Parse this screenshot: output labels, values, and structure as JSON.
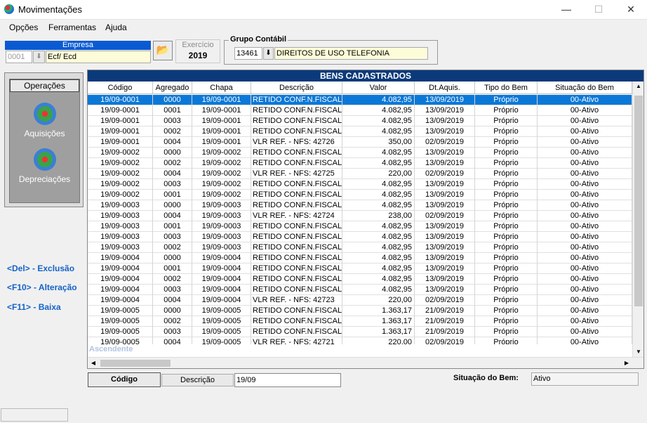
{
  "window": {
    "title": "Movimentações"
  },
  "menu": {
    "items": [
      "Opções",
      "Ferramentas",
      "Ajuda"
    ]
  },
  "empresa": {
    "label": "Empresa",
    "code": "0001",
    "name": "Ecf/ Ecd"
  },
  "exercicio": {
    "label": "Exercício",
    "value": "2019"
  },
  "grupo": {
    "label": "Grupo  Contábil",
    "code": "13461",
    "name": "DIREITOS DE USO TELEFONIA"
  },
  "operacoes": {
    "title": "Operações",
    "items": [
      "Aquisições",
      "Depreciações"
    ]
  },
  "hotkeys": [
    "<Del> - Exclusão",
    "<F10> - Alteração",
    "<F11> - Baixa"
  ],
  "grid": {
    "title": "BENS CADASTRADOS",
    "columns": [
      "Código",
      "Agregado",
      "Chapa",
      "Descrição",
      "Valor",
      "Dt.Aquis.",
      "Tipo do Bem",
      "Situação do Bem"
    ],
    "rows": [
      [
        "19/09-0001",
        "0000",
        "19/09-0001",
        "RETIDO CONF.N.FISCAL -",
        "4.082,95",
        "13/09/2019",
        "Próprio",
        "00-Ativo"
      ],
      [
        "19/09-0001",
        "0001",
        "19/09-0001",
        "RETIDO CONF.N.FISCAL -",
        "4.082,95",
        "13/09/2019",
        "Próprio",
        "00-Ativo"
      ],
      [
        "19/09-0001",
        "0003",
        "19/09-0001",
        "RETIDO CONF.N.FISCAL -",
        "4.082,95",
        "13/09/2019",
        "Próprio",
        "00-Ativo"
      ],
      [
        "19/09-0001",
        "0002",
        "19/09-0001",
        "RETIDO CONF.N.FISCAL -",
        "4.082,95",
        "13/09/2019",
        "Próprio",
        "00-Ativo"
      ],
      [
        "19/09-0001",
        "0004",
        "19/09-0001",
        "VLR REF. - NFS: 42726",
        "350,00",
        "02/09/2019",
        "Próprio",
        "00-Ativo"
      ],
      [
        "19/09-0002",
        "0000",
        "19/09-0002",
        "RETIDO CONF.N.FISCAL -",
        "4.082,95",
        "13/09/2019",
        "Próprio",
        "00-Ativo"
      ],
      [
        "19/09-0002",
        "0002",
        "19/09-0002",
        "RETIDO CONF.N.FISCAL -",
        "4.082,95",
        "13/09/2019",
        "Próprio",
        "00-Ativo"
      ],
      [
        "19/09-0002",
        "0004",
        "19/09-0002",
        "VLR REF. - NFS: 42725",
        "220,00",
        "02/09/2019",
        "Próprio",
        "00-Ativo"
      ],
      [
        "19/09-0002",
        "0003",
        "19/09-0002",
        "RETIDO CONF.N.FISCAL -",
        "4.082,95",
        "13/09/2019",
        "Próprio",
        "00-Ativo"
      ],
      [
        "19/09-0002",
        "0001",
        "19/09-0002",
        "RETIDO CONF.N.FISCAL -",
        "4.082,95",
        "13/09/2019",
        "Próprio",
        "00-Ativo"
      ],
      [
        "19/09-0003",
        "0000",
        "19/09-0003",
        "RETIDO CONF.N.FISCAL -",
        "4.082,95",
        "13/09/2019",
        "Próprio",
        "00-Ativo"
      ],
      [
        "19/09-0003",
        "0004",
        "19/09-0003",
        "VLR REF. - NFS: 42724",
        "238,00",
        "02/09/2019",
        "Próprio",
        "00-Ativo"
      ],
      [
        "19/09-0003",
        "0001",
        "19/09-0003",
        "RETIDO CONF.N.FISCAL -",
        "4.082,95",
        "13/09/2019",
        "Próprio",
        "00-Ativo"
      ],
      [
        "19/09-0003",
        "0003",
        "19/09-0003",
        "RETIDO CONF.N.FISCAL -",
        "4.082,95",
        "13/09/2019",
        "Próprio",
        "00-Ativo"
      ],
      [
        "19/09-0003",
        "0002",
        "19/09-0003",
        "RETIDO CONF.N.FISCAL -",
        "4.082,95",
        "13/09/2019",
        "Próprio",
        "00-Ativo"
      ],
      [
        "19/09-0004",
        "0000",
        "19/09-0004",
        "RETIDO CONF.N.FISCAL -",
        "4.082,95",
        "13/09/2019",
        "Próprio",
        "00-Ativo"
      ],
      [
        "19/09-0004",
        "0001",
        "19/09-0004",
        "RETIDO CONF.N.FISCAL -",
        "4.082,95",
        "13/09/2019",
        "Próprio",
        "00-Ativo"
      ],
      [
        "19/09-0004",
        "0002",
        "19/09-0004",
        "RETIDO CONF.N.FISCAL -",
        "4.082,95",
        "13/09/2019",
        "Próprio",
        "00-Ativo"
      ],
      [
        "19/09-0004",
        "0003",
        "19/09-0004",
        "RETIDO CONF.N.FISCAL -",
        "4.082,95",
        "13/09/2019",
        "Próprio",
        "00-Ativo"
      ],
      [
        "19/09-0004",
        "0004",
        "19/09-0004",
        "VLR REF. - NFS: 42723",
        "220,00",
        "02/09/2019",
        "Próprio",
        "00-Ativo"
      ],
      [
        "19/09-0005",
        "0000",
        "19/09-0005",
        "RETIDO CONF.N.FISCAL -",
        "1.363,17",
        "21/09/2019",
        "Próprio",
        "00-Ativo"
      ],
      [
        "19/09-0005",
        "0002",
        "19/09-0005",
        "RETIDO CONF.N.FISCAL -",
        "1.363,17",
        "21/09/2019",
        "Próprio",
        "00-Ativo"
      ],
      [
        "19/09-0005",
        "0003",
        "19/09-0005",
        "RETIDO CONF.N.FISCAL -",
        "1.363,17",
        "21/09/2019",
        "Próprio",
        "00-Ativo"
      ],
      [
        "19/09-0005",
        "0004",
        "19/09-0005",
        "VLR REF. - NFS: 42721",
        "220,00",
        "02/09/2019",
        "Próprio",
        "00-Ativo"
      ]
    ],
    "selected_row": 0,
    "sort_label": "Ascendente"
  },
  "search": {
    "tab_codigo": "Código",
    "tab_descricao": "Descrição",
    "value": "19/09"
  },
  "situacao": {
    "label": "Situação do Bem:",
    "value": "Ativo"
  },
  "colors": {
    "accent": "#0a5bd3",
    "grid_title": "#0b3a7a",
    "selection": "#0b78d7",
    "hotkey": "#1463c7"
  }
}
